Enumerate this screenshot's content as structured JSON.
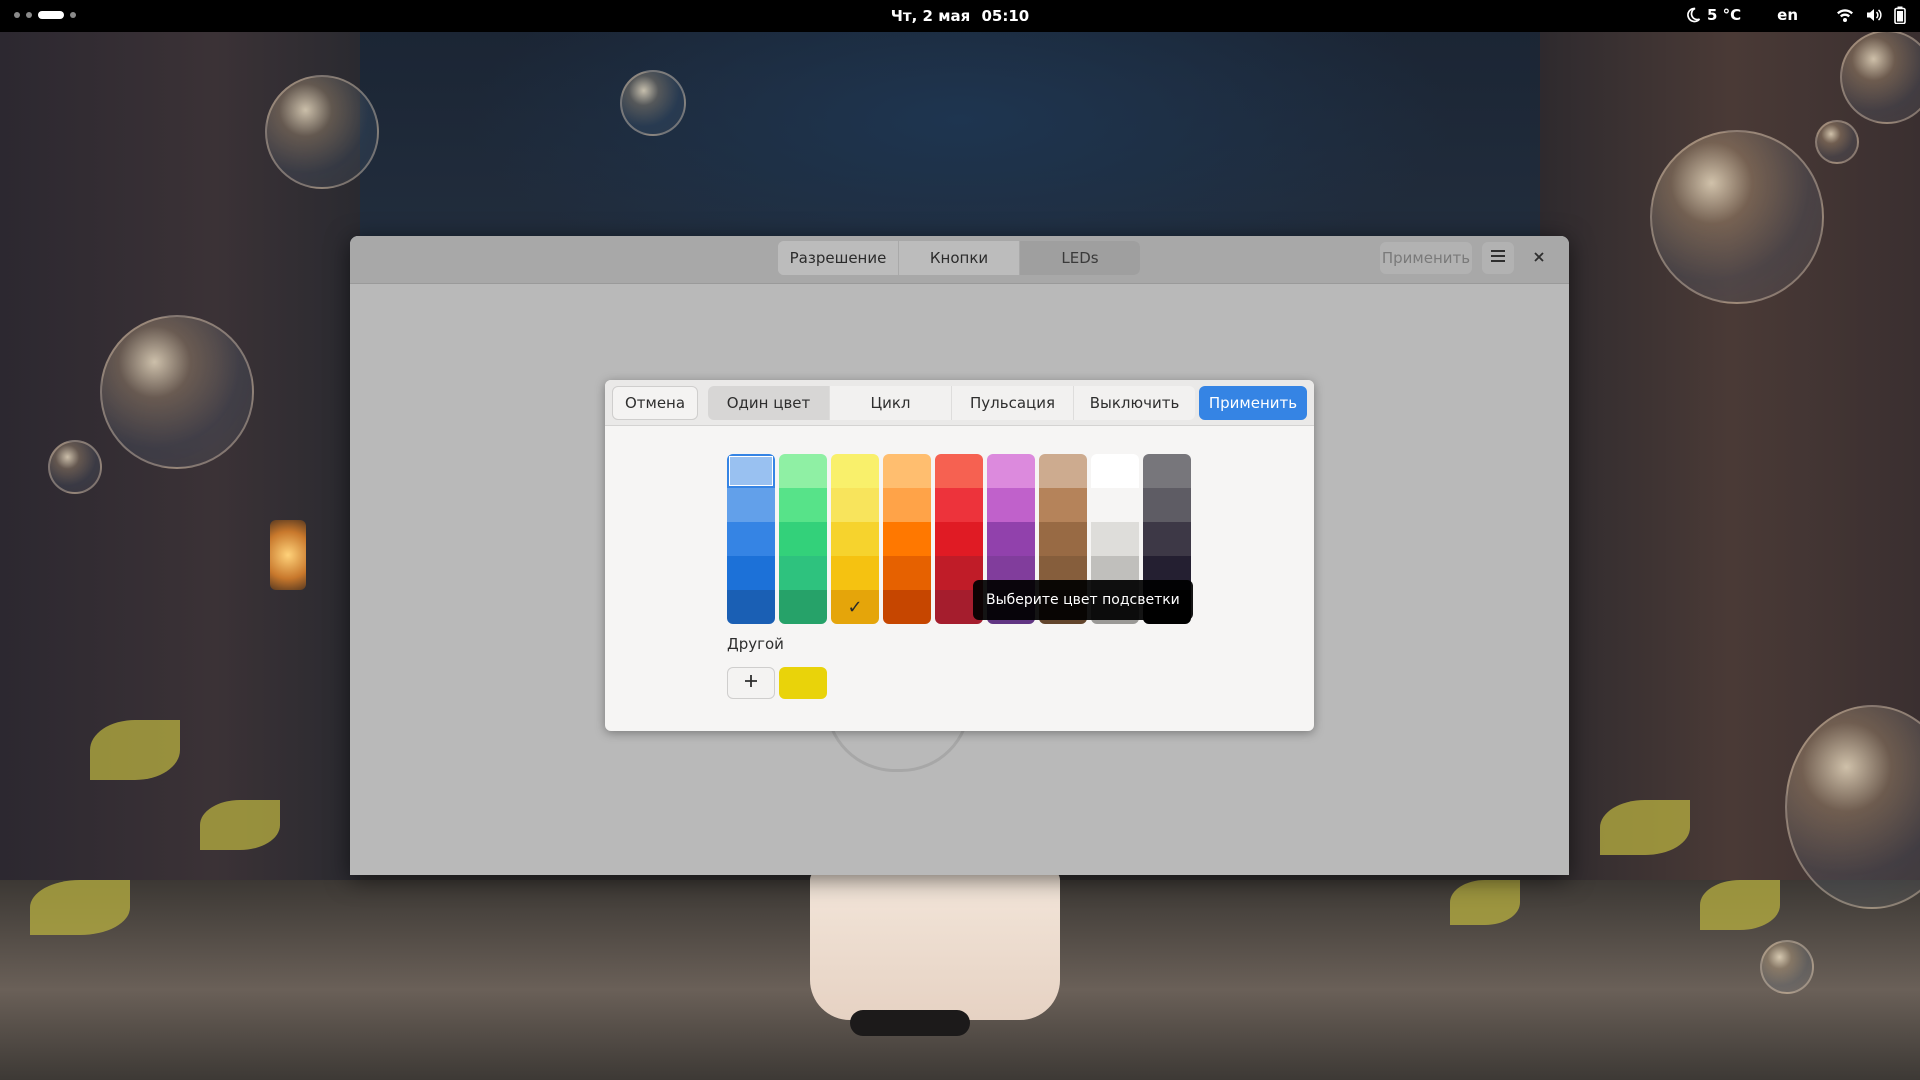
{
  "topbar": {
    "date": "Чт, 2 мая",
    "time": "05:10",
    "weather_icon": "moon-icon",
    "temperature": "5 °C",
    "language": "en",
    "tray_icons": [
      "wifi-icon",
      "volume-icon",
      "battery-icon"
    ]
  },
  "window": {
    "tabs": [
      {
        "label": "Разрешение",
        "active": false
      },
      {
        "label": "Кнопки",
        "active": false
      },
      {
        "label": "LEDs",
        "active": true
      }
    ],
    "apply_label": "Применить",
    "menu_icon": "hamburger-menu-icon",
    "close_icon": "close-icon"
  },
  "popover": {
    "cancel_label": "Отмена",
    "modes": [
      {
        "label": "Один цвет",
        "active": true
      },
      {
        "label": "Цикл",
        "active": false
      },
      {
        "label": "Пульсация",
        "active": false
      },
      {
        "label": "Выключить",
        "active": false
      }
    ],
    "apply_label": "Применить",
    "palette": [
      [
        "#99c1f1",
        "#62a0ea",
        "#3584e4",
        "#1c71d8",
        "#1a5fb4"
      ],
      [
        "#8ff0a4",
        "#57e389",
        "#33d17a",
        "#2ec27e",
        "#26a269"
      ],
      [
        "#f9f06b",
        "#f8e45c",
        "#f6d32d",
        "#f5c211",
        "#e5a50a"
      ],
      [
        "#ffbe6f",
        "#ffa348",
        "#ff7800",
        "#e66100",
        "#c64600"
      ],
      [
        "#f66151",
        "#ed333b",
        "#e01b24",
        "#c01c28",
        "#a51d2d"
      ],
      [
        "#dc8add",
        "#c061cb",
        "#9141ac",
        "#813d9c",
        "#613583"
      ],
      [
        "#cdab8f",
        "#b5835a",
        "#986a44",
        "#865e3c",
        "#63452c"
      ],
      [
        "#ffffff",
        "#f6f5f4",
        "#deddda",
        "#c0bfbc",
        "#9a9996"
      ],
      [
        "#77767b",
        "#5e5c64",
        "#3d3846",
        "#241f31",
        "#000000"
      ]
    ],
    "selected_palette_cell": [
      0,
      0
    ],
    "checked_palette_cell": [
      2,
      4
    ],
    "tooltip": "Выберите цвет подсветки",
    "other_label": "Другой",
    "custom_color": "#e9d30a"
  }
}
